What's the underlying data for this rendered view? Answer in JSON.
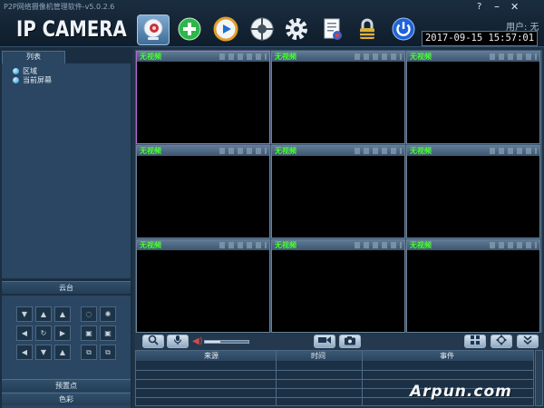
{
  "window": {
    "title": "P2P网络摄像机管理软件-v5.0.2.6",
    "help": "?",
    "minimize": "–",
    "close": "✕"
  },
  "logo": "IP CAMERA",
  "toolbar": {
    "items": [
      {
        "icon": "camera-icon"
      },
      {
        "icon": "add-device-icon"
      },
      {
        "icon": "playback-icon"
      },
      {
        "icon": "ptz-wheel-icon"
      },
      {
        "icon": "settings-gear-icon"
      },
      {
        "icon": "log-document-icon"
      },
      {
        "icon": "lock-icon"
      },
      {
        "icon": "power-icon"
      }
    ]
  },
  "user": {
    "label": "用户: 无"
  },
  "clock": "2017-09-15  15:57:01",
  "sidebar": {
    "tab": "列表",
    "tree": [
      "区域",
      "当前屏幕"
    ],
    "ptz_title": "云台",
    "preset_title": "预置点",
    "color_title": "色彩"
  },
  "grid": {
    "cells": [
      "无视频",
      "无视频",
      "无视频",
      "无视频",
      "无视频",
      "无视频",
      "无视频",
      "无视频",
      "无视频"
    ]
  },
  "volume": {
    "level": 0.35
  },
  "log": {
    "columns": [
      "来源",
      "时间",
      "事件"
    ]
  },
  "watermark": "Arpun.com",
  "colors": {
    "accent": "#b46bd0",
    "no_signal": "#46ff2e"
  }
}
